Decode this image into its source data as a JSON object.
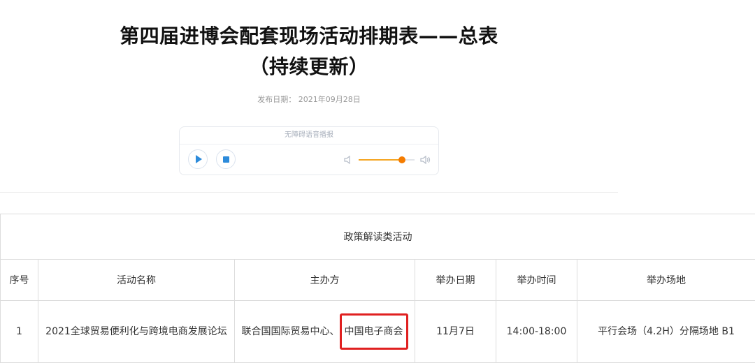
{
  "title_line1": "第四届进博会配套现场活动排期表——总表",
  "title_line2": "（持续更新）",
  "publish_label": "发布日期：",
  "publish_date": "2021年09月28日",
  "player": {
    "header": "无障碍语音播报",
    "volume_level": 0.78,
    "accent_color": "#f57c00",
    "icons": [
      "play-icon",
      "stop-icon",
      "volume-low-icon",
      "volume-high-icon"
    ]
  },
  "table": {
    "caption": "政策解读类活动",
    "headers": [
      "序号",
      "活动名称",
      "主办方",
      "举办日期",
      "举办时间",
      "举办场地"
    ],
    "rows": [
      {
        "index": "1",
        "name": "2021全球贸易便利化与跨境电商发展论坛",
        "organizer_part1": "联合国国际贸易中心、",
        "organizer_part2": "中国电子商会",
        "date": "11月7日",
        "time": "14:00-18:00",
        "venue": "平行会场（4.2H）分隔场地 B1"
      }
    ],
    "highlight_color": "#e02020"
  }
}
